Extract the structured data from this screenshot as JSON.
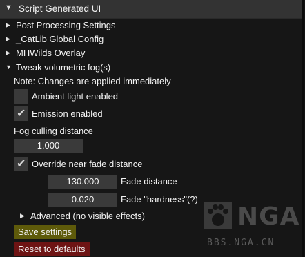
{
  "window": {
    "title": "Script Generated UI",
    "collapse_icon": "triangle-down"
  },
  "tree": [
    {
      "label": "Post Processing Settings",
      "icon": "triangle-right",
      "expanded": false
    },
    {
      "label": "_CatLib Global Config",
      "icon": "triangle-right",
      "expanded": false
    },
    {
      "label": "MHWilds Overlay",
      "icon": "triangle-right",
      "expanded": false
    },
    {
      "label": "Tweak volumetric fog(s)",
      "icon": "triangle-down",
      "expanded": true
    }
  ],
  "fog": {
    "note": "Note: Changes are applied immediately",
    "ambient": {
      "label": "Ambient light enabled",
      "checked": false
    },
    "emission": {
      "label": "Emission enabled",
      "checked": true
    },
    "culling": {
      "label": "Fog culling distance",
      "value": "1.000"
    },
    "override": {
      "label": "Override near fade distance",
      "checked": true
    },
    "fade_distance": {
      "label": "Fade distance",
      "value": "130.000"
    },
    "fade_hardness": {
      "label": "Fade \"hardness\"(?)",
      "value": "0.020"
    },
    "advanced": {
      "label": "Advanced (no visible effects)",
      "icon": "triangle-right"
    },
    "save_button": "Save settings",
    "reset_button": "Reset to defaults"
  },
  "watermark": {
    "logo": "NGA",
    "url": "BBS.NGA.CN"
  },
  "colors": {
    "background": "#161616",
    "titlebar": "#333333",
    "widget": "#3a3a3a",
    "save": "#5e5a0a",
    "reset": "#6e1414"
  }
}
